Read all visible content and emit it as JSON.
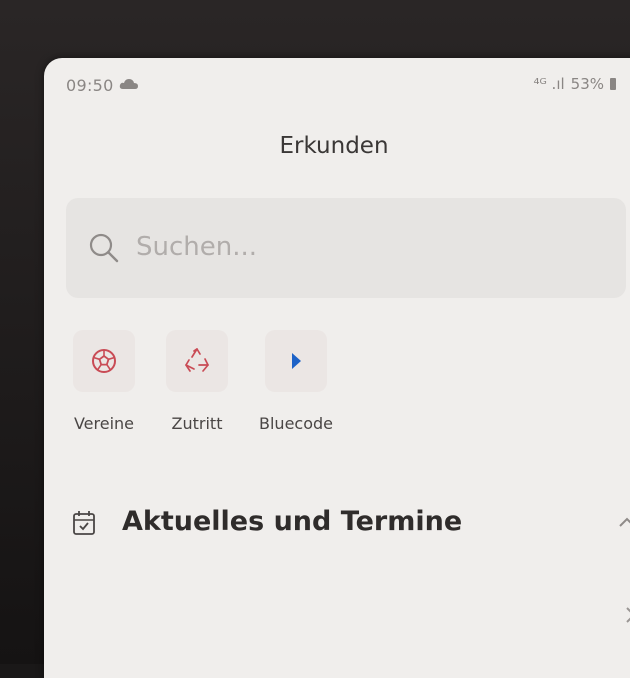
{
  "status_bar": {
    "time": "09:50",
    "signal": "⁴ᴳ .ıl",
    "battery": "53%"
  },
  "header": {
    "title": "Erkunden"
  },
  "search": {
    "placeholder": "Suchen..."
  },
  "quick_actions": [
    {
      "label": "Vereine",
      "icon": "soccer-ball-icon",
      "color": "#c94b55"
    },
    {
      "label": "Zutritt",
      "icon": "recycle-icon",
      "color": "#c94b55"
    },
    {
      "label": "Bluecode",
      "icon": "bluecode-icon",
      "color": "#1d62c7"
    }
  ],
  "sections": [
    {
      "title": "Aktuelles und Termine",
      "icon": "calendar-check-icon",
      "expanded": true
    }
  ]
}
